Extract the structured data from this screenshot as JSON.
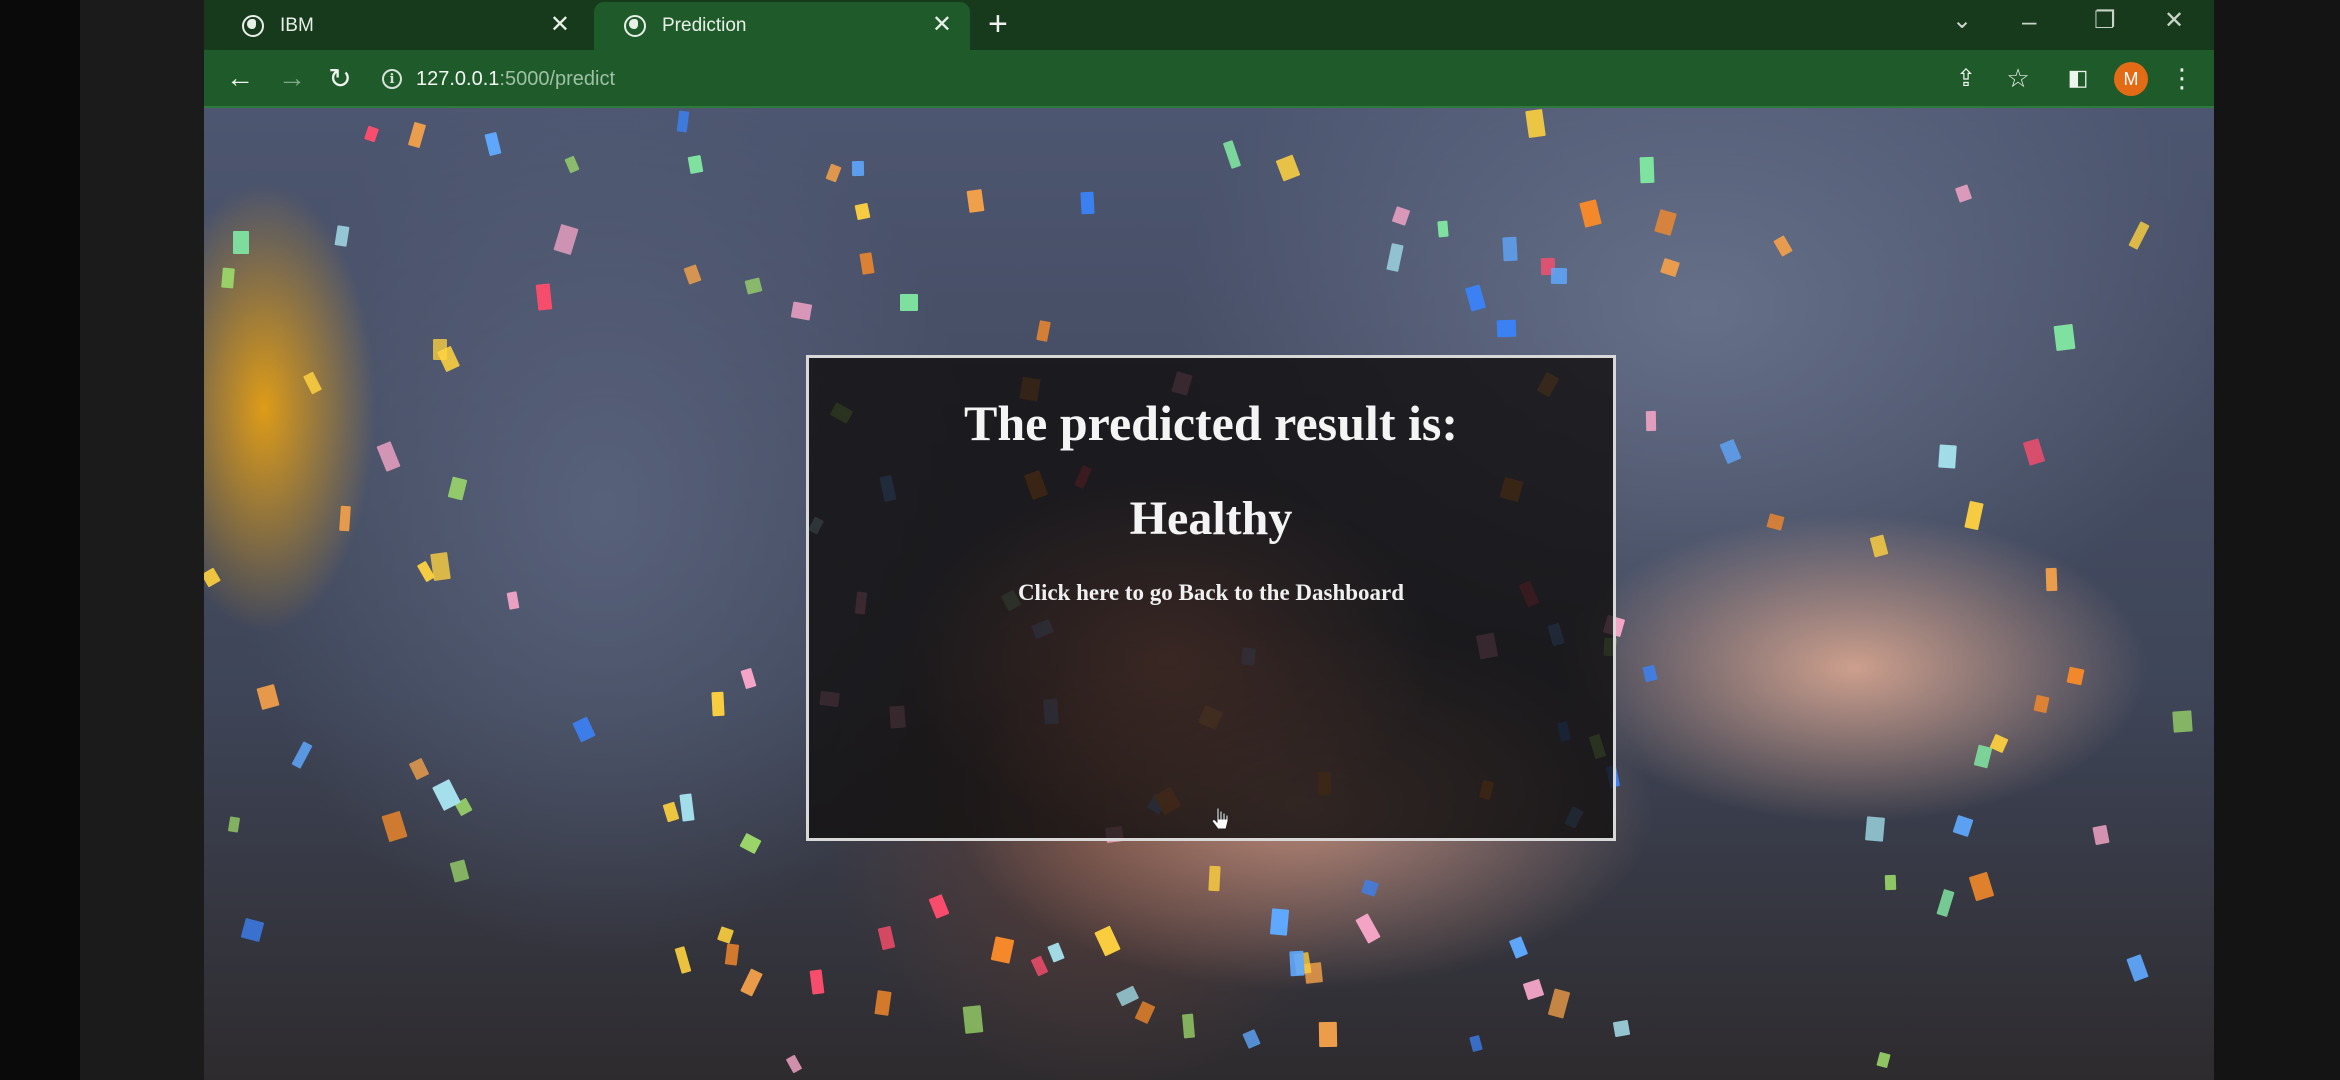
{
  "browser": {
    "tabs": [
      {
        "label": "IBM",
        "active": false,
        "favicon": "globe-icon"
      },
      {
        "label": "Prediction",
        "active": true,
        "favicon": "globe-icon"
      }
    ],
    "new_tab_icon": "plus-icon",
    "window_controls": [
      "chevron-down-icon",
      "minimize-icon",
      "restore-icon",
      "close-icon"
    ],
    "address": {
      "host": "127.0.0.1",
      "path": ":5000/predict",
      "info_icon": "info-icon"
    },
    "toolbar_icons": [
      "back-arrow-icon",
      "forward-arrow-icon",
      "reload-icon",
      "share-icon",
      "star-icon",
      "side-panel-icon",
      "kebab-menu-icon"
    ],
    "profile_initial": "M",
    "profile_color": "#e46b15",
    "theme_color": "#1f5a2a"
  },
  "page": {
    "title": "The predicted result is:",
    "result": "Healthy",
    "back_link": "Click here to go Back to the Dashboard",
    "background": "photo of hands on a steering wheel with falling confetti",
    "confetti_colors": [
      "#f6a6c8",
      "#f4a14a",
      "#5fa8ff",
      "#7fe3a0",
      "#ffd23f",
      "#ff4d6d",
      "#a7e4f0",
      "#f78a2a",
      "#9bd86a",
      "#3b82f6"
    ]
  }
}
